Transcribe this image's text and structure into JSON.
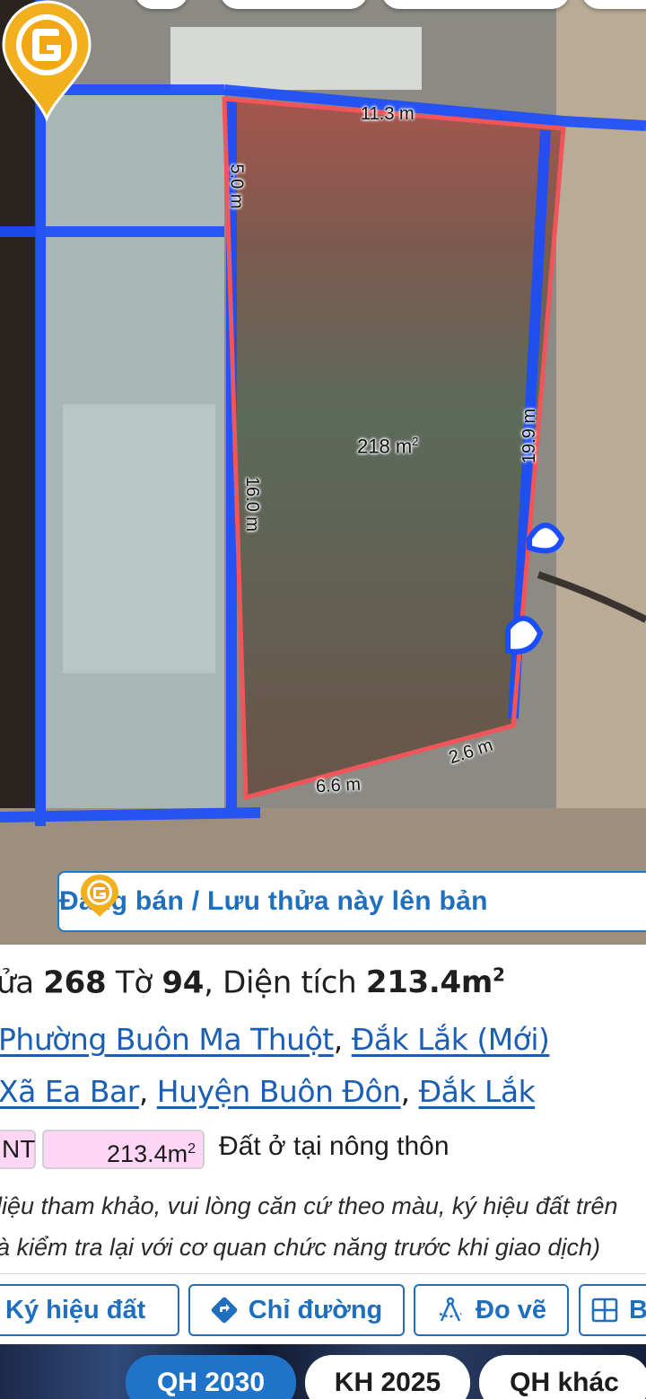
{
  "map": {
    "dimensions": {
      "top": "11.3 m",
      "left_upper": "5.0 m",
      "left_lower": "16.0 m",
      "right": "19.9 m",
      "bottom_right": "2.6 m",
      "bottom_left": "6.6 m"
    },
    "area_value": "218 m",
    "area_unit_sup": "2",
    "pin_icon": "location-pin-g-logo",
    "banner_text": "Đăng bán / Lưu thửa này lên bản",
    "colors": {
      "parcel_outline": "#f0555a",
      "parcel_grid": "#1a4dff",
      "accent_blue": "#1f6fbf",
      "pin_gold": "#f2b01e"
    }
  },
  "parcel": {
    "title_prefix": "ửa ",
    "parcel_no": "268",
    "sheet_label": " Tờ ",
    "sheet_no": "94",
    "area_label": ", Diện tích ",
    "area_value": "213.4m",
    "area_sup": "2",
    "new_address": {
      "ward": "Phường Buôn Ma Thuột",
      "sep": ", ",
      "province": "Đắk Lắk (Mới)"
    },
    "old_address": {
      "commune": "Xã Ea Bar",
      "sep1": ", ",
      "district": "Huyện Buôn Đôn",
      "sep2": ", ",
      "province": "Đắk Lắk"
    },
    "land_use": {
      "code": "NT",
      "area": "213.4m",
      "area_sup": "2",
      "name": "Đất ở tại nông thôn",
      "color": "#ffd6f5"
    },
    "note_line1": "liệu tham khảo, vui lòng căn cứ theo màu, ký hiệu đất trên",
    "note_line2": "à kiểm tra lại với cơ quan chức năng trước khi giao dịch)"
  },
  "actions": {
    "legend_label": "Ký hiệu đất",
    "directions_label": "Chỉ đường",
    "draw_label": "Đo vẽ",
    "more_label": "B"
  },
  "bottom_tabs": [
    {
      "label": "QH 2030",
      "active": true
    },
    {
      "label": "KH 2025",
      "active": false
    },
    {
      "label": "QH khác",
      "active": false
    }
  ]
}
